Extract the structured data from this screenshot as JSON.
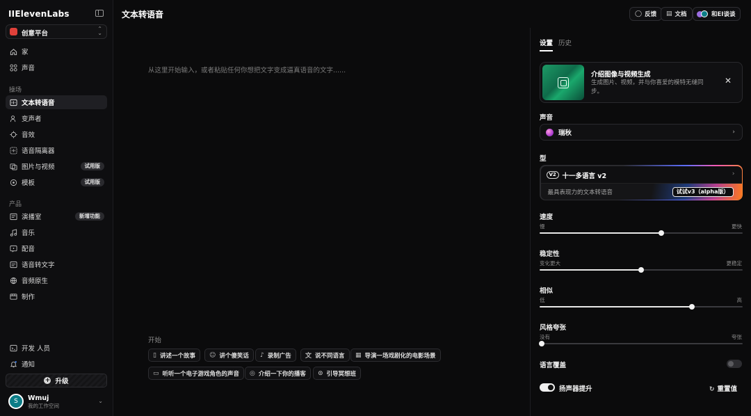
{
  "app": {
    "logo": "IIElevenLabs",
    "page_title": "文本转语音"
  },
  "workspace": {
    "label": "创意平台"
  },
  "nav": {
    "top": [
      {
        "label": "家",
        "icon": "home-icon"
      },
      {
        "label": "声音",
        "icon": "voices-icon"
      }
    ],
    "section1": "操场",
    "playground": [
      {
        "label": "文本转语音",
        "icon": "tts-icon",
        "active": true,
        "badge": ""
      },
      {
        "label": "变声者",
        "icon": "voice-changer-icon",
        "badge": ""
      },
      {
        "label": "音效",
        "icon": "sound-effects-icon",
        "badge": ""
      },
      {
        "label": "语音隔离器",
        "icon": "voice-isolator-icon",
        "badge": ""
      },
      {
        "label": "图片与视频",
        "icon": "image-video-icon",
        "badge": "试用版"
      },
      {
        "label": "模板",
        "icon": "templates-icon",
        "badge": "试用版"
      }
    ],
    "section2": "产品",
    "products": [
      {
        "label": "演播室",
        "icon": "studio-icon",
        "badge": "新增功能"
      },
      {
        "label": "音乐",
        "icon": "music-icon",
        "badge": ""
      },
      {
        "label": "配音",
        "icon": "dubbing-icon",
        "badge": ""
      },
      {
        "label": "语音转文字",
        "icon": "speech-to-text-icon",
        "badge": ""
      },
      {
        "label": "音频原生",
        "icon": "audio-native-icon",
        "badge": ""
      },
      {
        "label": "制作",
        "icon": "productions-icon",
        "badge": ""
      }
    ],
    "bottom": [
      {
        "label": "开发 人员",
        "icon": "developers-icon"
      },
      {
        "label": "通知",
        "icon": "bell-icon"
      }
    ],
    "upgrade": "升级"
  },
  "user": {
    "initial": "S",
    "name": "Wmuj",
    "workspace": "我的工作空间"
  },
  "topbar": {
    "feedback": "反馈",
    "docs": "文档",
    "talk": "和EI谈谈"
  },
  "editor": {
    "placeholder": "从这里开始输入，或者粘贴任何你想把文字变成逼真语音的文字......",
    "start_label": "开始",
    "chips": [
      "讲述一个故事",
      "讲个傻笑话",
      "录制广告",
      "说不同语言",
      "导演一场戏剧化的电影场景",
      "听听一个电子游戏角色的声音",
      "介绍一下你的播客",
      "引导冥想班"
    ]
  },
  "panel": {
    "tabs": [
      "设置",
      "历史"
    ],
    "promo": {
      "title": "介绍图像与视频生成",
      "desc": "生成图片、视频，并与你喜爱的模特无缝同步。"
    },
    "voice_label": "声音",
    "voice_name": "瑞秋",
    "model_label": "型",
    "model_tag": "V2",
    "model_name": "十一多语言 v2",
    "model_desc": "最具表现力的文本转语音",
    "model_try": "试试v3（alpha版）",
    "sliders": [
      {
        "label": "速度",
        "left": "慢",
        "right": "更快",
        "value": 0.6
      },
      {
        "label": "稳定性",
        "left": "变化更大",
        "right": "更稳定",
        "value": 0.5
      },
      {
        "label": "相似",
        "left": "低",
        "right": "高",
        "value": 0.75
      },
      {
        "label": "风格夸张",
        "left": "没有",
        "right": "夸张",
        "value": 0.01
      }
    ],
    "lang_override": {
      "label": "语言覆盖",
      "on": false
    },
    "speaker_boost": {
      "label": "扬声器提升",
      "on": true
    },
    "reset": "重置值"
  }
}
